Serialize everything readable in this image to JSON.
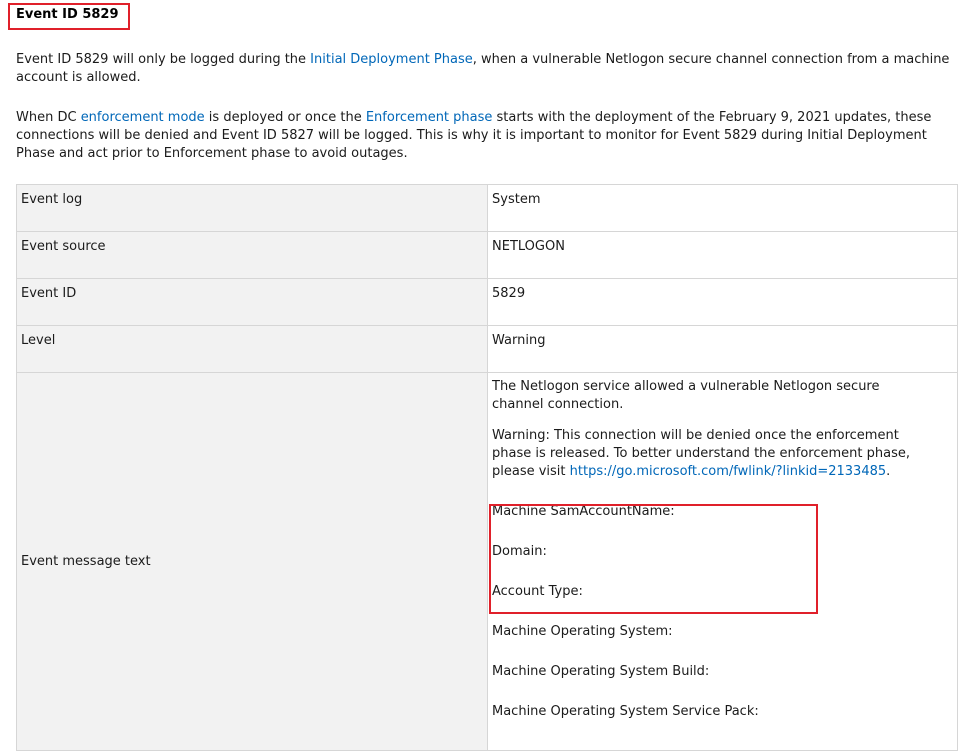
{
  "heading": "Event ID 5829",
  "paragraph1": {
    "before": "Event ID 5829 will only be logged during the ",
    "link": "Initial Deployment Phase",
    "after": ", when a vulnerable Netlogon secure channel connection from a machine account is allowed."
  },
  "paragraph2": {
    "before": "When DC ",
    "link1": "enforcement mode",
    "middle": " is deployed or once the ",
    "link2": "Enforcement phase",
    "after": " starts with the deployment of the February 9, 2021 updates, these connections will be denied and Event ID 5827 will be logged. This is why it is important to monitor for Event 5829 during Initial Deployment Phase and act prior to Enforcement phase to avoid outages."
  },
  "table": {
    "rows": [
      {
        "label": "Event log",
        "value": "System"
      },
      {
        "label": "Event source",
        "value": "NETLOGON"
      },
      {
        "label": "Event ID",
        "value": "5829"
      },
      {
        "label": "Level",
        "value": "Warning"
      }
    ],
    "message_row": {
      "label": "Event message text",
      "line1": "The Netlogon service allowed a vulnerable Netlogon secure channel connection.",
      "line2_before": "Warning: This connection will be denied once the enforcement phase is released. To better understand the enforcement phase, please visit ",
      "line2_link": "https://go.microsoft.com/fwlink/?linkid=2133485",
      "line2_after": ".",
      "fields": [
        "Machine SamAccountName:",
        "Domain:",
        "Account Type:",
        "Machine Operating System:",
        "Machine Operating System Build:",
        "Machine Operating System Service Pack:"
      ]
    }
  },
  "colors": {
    "link": "#0067b8",
    "highlight_border": "#e0202a",
    "label_cell_bg": "#f2f2f2",
    "border": "#d6d6d6"
  }
}
